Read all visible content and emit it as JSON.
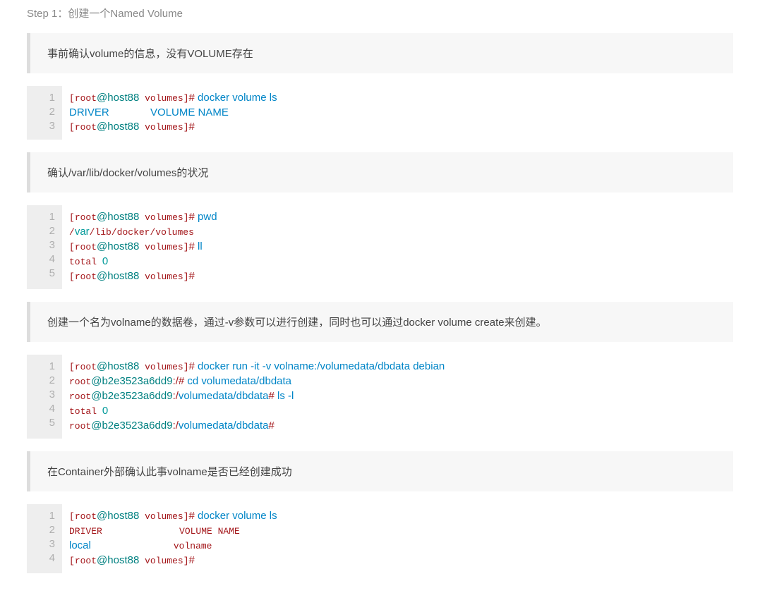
{
  "title": "Step 1：创建一个Named Volume",
  "blocks": [
    {
      "type": "text",
      "text": "事前确认volume的信息，没有VOLUME存在"
    },
    {
      "type": "code",
      "lines": [
        [
          {
            "t": "[",
            "c": "tok-red mono"
          },
          {
            "t": "root",
            "c": "tok-red mono"
          },
          {
            "t": "@host88",
            "c": "tok-teal"
          },
          {
            "t": " volumes",
            "c": "tok-red mono"
          },
          {
            "t": "]",
            "c": "tok-red mono"
          },
          {
            "t": "# ",
            "c": "tok-br"
          },
          {
            "t": "docker volume ls",
            "c": "tok-blue"
          }
        ],
        [
          {
            "t": "DRIVER              VOLUME NAME",
            "c": "tok-blue"
          }
        ],
        [
          {
            "t": "[",
            "c": "tok-red mono"
          },
          {
            "t": "root",
            "c": "tok-red mono"
          },
          {
            "t": "@host88",
            "c": "tok-teal"
          },
          {
            "t": " volumes",
            "c": "tok-red mono"
          },
          {
            "t": "]",
            "c": "tok-red mono"
          },
          {
            "t": "# ",
            "c": "tok-br"
          }
        ]
      ]
    },
    {
      "type": "text",
      "text": "确认/var/lib/docker/volumes的状况"
    },
    {
      "type": "code",
      "lines": [
        [
          {
            "t": "[",
            "c": "tok-red mono"
          },
          {
            "t": "root",
            "c": "tok-red mono"
          },
          {
            "t": "@host88",
            "c": "tok-teal"
          },
          {
            "t": " volumes",
            "c": "tok-red mono"
          },
          {
            "t": "]",
            "c": "tok-red mono"
          },
          {
            "t": "# ",
            "c": "tok-br"
          },
          {
            "t": "pwd",
            "c": "tok-blue"
          }
        ],
        [
          {
            "t": "/",
            "c": "tok-red mono"
          },
          {
            "t": "var",
            "c": "tok-num"
          },
          {
            "t": "/lib/docker/volumes",
            "c": "tok-red mono"
          }
        ],
        [
          {
            "t": "[",
            "c": "tok-red mono"
          },
          {
            "t": "root",
            "c": "tok-red mono"
          },
          {
            "t": "@host88",
            "c": "tok-teal"
          },
          {
            "t": " volumes",
            "c": "tok-red mono"
          },
          {
            "t": "]",
            "c": "tok-red mono"
          },
          {
            "t": "# ",
            "c": "tok-br"
          },
          {
            "t": "ll",
            "c": "tok-blue"
          }
        ],
        [
          {
            "t": "total ",
            "c": "tok-red mono"
          },
          {
            "t": "0",
            "c": "tok-num"
          }
        ],
        [
          {
            "t": "[",
            "c": "tok-red mono"
          },
          {
            "t": "root",
            "c": "tok-red mono"
          },
          {
            "t": "@host88",
            "c": "tok-teal"
          },
          {
            "t": " volumes",
            "c": "tok-red mono"
          },
          {
            "t": "]",
            "c": "tok-red mono"
          },
          {
            "t": "# ",
            "c": "tok-br"
          }
        ]
      ]
    },
    {
      "type": "text",
      "text": "创建一个名为volname的数据卷，通过-v参数可以进行创建，同时也可以通过docker volume create来创建。"
    },
    {
      "type": "code",
      "lines": [
        [
          {
            "t": "[",
            "c": "tok-red mono"
          },
          {
            "t": "root",
            "c": "tok-red mono"
          },
          {
            "t": "@host88",
            "c": "tok-teal"
          },
          {
            "t": " volumes",
            "c": "tok-red mono"
          },
          {
            "t": "]",
            "c": "tok-red mono"
          },
          {
            "t": "# ",
            "c": "tok-br"
          },
          {
            "t": "docker run -it -v volname:/volumedata/dbdata debian",
            "c": "tok-blue"
          }
        ],
        [
          {
            "t": "root",
            "c": "tok-red mono"
          },
          {
            "t": "@b2e3523a6dd9",
            "c": "tok-teal"
          },
          {
            "t": ":/",
            "c": "tok-red"
          },
          {
            "t": "# ",
            "c": "tok-br"
          },
          {
            "t": "cd volumedata/dbdata",
            "c": "tok-blue"
          }
        ],
        [
          {
            "t": "root",
            "c": "tok-red mono"
          },
          {
            "t": "@b2e3523a6dd9",
            "c": "tok-teal"
          },
          {
            "t": ":/",
            "c": "tok-red"
          },
          {
            "t": "volumedata/dbdata",
            "c": "tok-path"
          },
          {
            "t": "# ",
            "c": "tok-br"
          },
          {
            "t": "ls -l",
            "c": "tok-blue"
          }
        ],
        [
          {
            "t": "total ",
            "c": "tok-red mono"
          },
          {
            "t": "0",
            "c": "tok-num"
          }
        ],
        [
          {
            "t": "root",
            "c": "tok-red mono"
          },
          {
            "t": "@b2e3523a6dd9",
            "c": "tok-teal"
          },
          {
            "t": ":/",
            "c": "tok-red"
          },
          {
            "t": "volumedata/dbdata",
            "c": "tok-path"
          },
          {
            "t": "# ",
            "c": "tok-br"
          }
        ]
      ]
    },
    {
      "type": "text",
      "text": "在Container外部确认此事volname是否已经创建成功"
    },
    {
      "type": "code",
      "lines": [
        [
          {
            "t": "[",
            "c": "tok-red mono"
          },
          {
            "t": "root",
            "c": "tok-red mono"
          },
          {
            "t": "@host88",
            "c": "tok-teal"
          },
          {
            "t": " volumes",
            "c": "tok-red mono"
          },
          {
            "t": "]",
            "c": "tok-red mono"
          },
          {
            "t": "# ",
            "c": "tok-br"
          },
          {
            "t": "docker volume ls",
            "c": "tok-blue"
          }
        ],
        [
          {
            "t": "DRIVER              VOLUME NAME",
            "c": "tok-red mono"
          }
        ],
        [
          {
            "t": "local",
            "c": "tok-kw"
          },
          {
            "t": "               volname",
            "c": "tok-red mono"
          }
        ],
        [
          {
            "t": "[",
            "c": "tok-red mono"
          },
          {
            "t": "root",
            "c": "tok-red mono"
          },
          {
            "t": "@host88",
            "c": "tok-teal"
          },
          {
            "t": " volumes",
            "c": "tok-red mono"
          },
          {
            "t": "]",
            "c": "tok-red mono"
          },
          {
            "t": "# ",
            "c": "tok-br"
          }
        ]
      ]
    }
  ]
}
